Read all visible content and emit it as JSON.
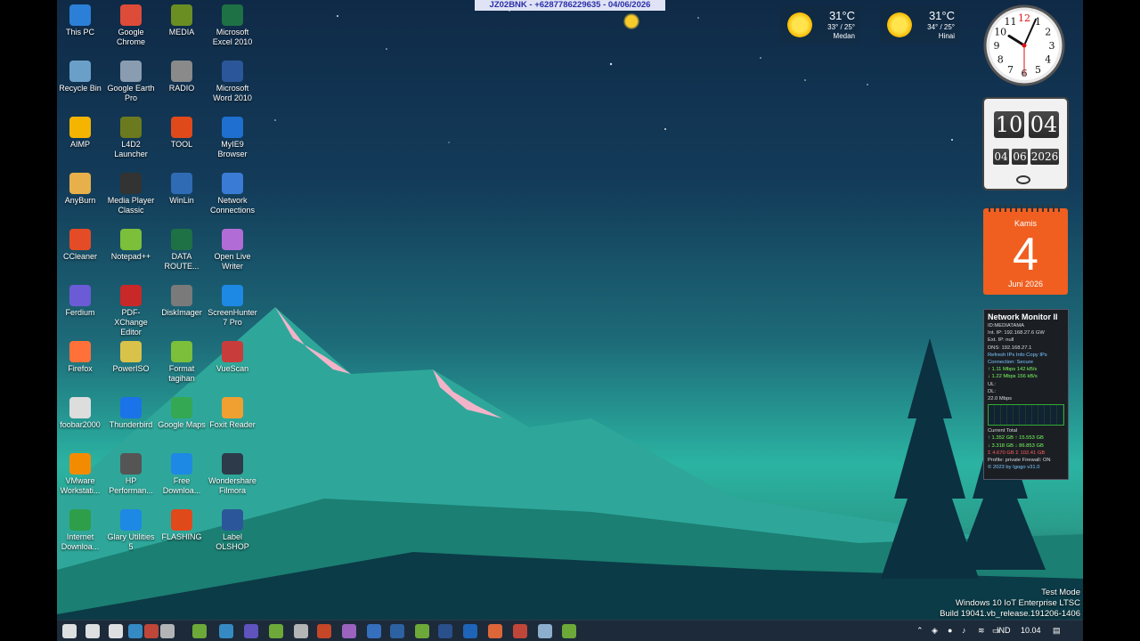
{
  "banner": "JZ02BNK - +6287786229635 - 04/06/2026",
  "desktop_icons": [
    {
      "label": "This PC",
      "icon": "computer-icon",
      "color": "#2b7fd6"
    },
    {
      "label": "Google Chrome",
      "icon": "chrome-icon",
      "color": "#dd4b39"
    },
    {
      "label": "MEDIA",
      "icon": "media-icon",
      "color": "#6b8e23"
    },
    {
      "label": "Microsoft Excel 2010",
      "icon": "excel-icon",
      "color": "#1e7145"
    },
    {
      "label": "Recycle Bin",
      "icon": "recycle-bin-icon",
      "color": "#6aa0c8"
    },
    {
      "label": "Google Earth Pro",
      "icon": "google-earth-icon",
      "color": "#8a9db0"
    },
    {
      "label": "RADIO",
      "icon": "radio-icon",
      "color": "#8a8a8a"
    },
    {
      "label": "Microsoft Word 2010",
      "icon": "word-icon",
      "color": "#2b579a"
    },
    {
      "label": "AIMP",
      "icon": "aimp-icon",
      "color": "#f5b400"
    },
    {
      "label": "L4D2 Launcher",
      "icon": "l4d2-icon",
      "color": "#6b7a1e"
    },
    {
      "label": "TOOL",
      "icon": "tool-icon",
      "color": "#e0491a"
    },
    {
      "label": "MyIE9 Browser",
      "icon": "myie9-icon",
      "color": "#1e6fcf"
    },
    {
      "label": "AnyBurn",
      "icon": "anyburn-icon",
      "color": "#e8b04a"
    },
    {
      "label": "Media Player Classic",
      "icon": "mpc-icon",
      "color": "#333333"
    },
    {
      "label": "WinLin",
      "icon": "winlin-icon",
      "color": "#2f6bb5"
    },
    {
      "label": "Network Connections",
      "icon": "network-icon",
      "color": "#3a7bd5"
    },
    {
      "label": "CCleaner",
      "icon": "ccleaner-icon",
      "color": "#e34c26"
    },
    {
      "label": "Notepad++",
      "icon": "notepadpp-icon",
      "color": "#7bbf3a"
    },
    {
      "label": "DATA ROUTE...",
      "icon": "excel-icon",
      "color": "#1e7145"
    },
    {
      "label": "Open Live Writer",
      "icon": "writer-icon",
      "color": "#b16cd6"
    },
    {
      "label": "Ferdium",
      "icon": "ferdium-icon",
      "color": "#6b5bd6"
    },
    {
      "label": "PDF-XChange Editor",
      "icon": "pdf-icon",
      "color": "#c82828"
    },
    {
      "label": "DiskImager",
      "icon": "diskimager-icon",
      "color": "#7a7a7a"
    },
    {
      "label": "ScreenHunter 7 Pro",
      "icon": "screenhunter-icon",
      "color": "#1e88e5"
    },
    {
      "label": "Firefox",
      "icon": "firefox-icon",
      "color": "#ff7139"
    },
    {
      "label": "PowerISO",
      "icon": "poweriso-icon",
      "color": "#d9c24a"
    },
    {
      "label": "Format tagihan",
      "icon": "notepadpp-icon",
      "color": "#7bbf3a"
    },
    {
      "label": "VueScan",
      "icon": "vuescan-icon",
      "color": "#c83c3c"
    },
    {
      "label": "foobar2000",
      "icon": "foobar-icon",
      "color": "#dddddd"
    },
    {
      "label": "Thunderbird",
      "icon": "thunderbird-icon",
      "color": "#1a73e8"
    },
    {
      "label": "Google Maps",
      "icon": "maps-icon",
      "color": "#34a853"
    },
    {
      "label": "Foxit Reader",
      "icon": "foxit-icon",
      "color": "#f0a030"
    },
    {
      "label": "VMware Workstati...",
      "icon": "vmware-icon",
      "color": "#f38b00"
    },
    {
      "label": "HP Performan...",
      "icon": "hp-icon",
      "color": "#555555"
    },
    {
      "label": "Free Downloa...",
      "icon": "download-icon",
      "color": "#1e88e5"
    },
    {
      "label": "Wondershare Filmora",
      "icon": "filmora-icon",
      "color": "#2d3a4a"
    },
    {
      "label": "Internet Downloa...",
      "icon": "idm-icon",
      "color": "#2e9e4a"
    },
    {
      "label": "Glary Utilities 5",
      "icon": "glary-icon",
      "color": "#1e88e5"
    },
    {
      "label": "FLASHING",
      "icon": "flashing-icon",
      "color": "#e0491a"
    },
    {
      "label": "Label OLSHOP",
      "icon": "word-icon",
      "color": "#2b579a"
    }
  ],
  "weather": [
    {
      "temp": "31°C",
      "range": "33° / 25°",
      "city": "Medan"
    },
    {
      "temp": "31°C",
      "range": "34° / 25°",
      "city": "Hinai"
    }
  ],
  "flip_clock": {
    "hour": "10",
    "minute": "04",
    "day": "04",
    "month": "06",
    "year": "2026"
  },
  "calendar": {
    "weekday": "Kamis",
    "day": "4",
    "month_year": "Juni 2026"
  },
  "network_monitor": {
    "title": "Network Monitor II",
    "lines": [
      {
        "text": "ID:MEDIATAMA",
        "cls": ""
      },
      {
        "text": "Int. IP: 192.168.27.6    GW",
        "cls": ""
      },
      {
        "text": "Ext. IP: null",
        "cls": ""
      },
      {
        "text": "DNS: 192.168.27.1",
        "cls": ""
      },
      {
        "text": "Refresh IPs   Info   Copy IPs",
        "cls": "b"
      },
      {
        "text": "Connection: Secure",
        "cls": "b"
      },
      {
        "text": "↑ 1.11 Mbps    142 kB/s",
        "cls": "g"
      },
      {
        "text": "↓ 1.22 Mbps    156 kB/s",
        "cls": "g"
      },
      {
        "text": "UL:",
        "cls": ""
      },
      {
        "text": "DL:",
        "cls": ""
      },
      {
        "text": "22.0 Mbps",
        "cls": ""
      }
    ],
    "totals": [
      {
        "text": "Current        Total",
        "cls": ""
      },
      {
        "text": "↑ 1.352 GB    ↑ 15.553 GB",
        "cls": "g"
      },
      {
        "text": "↓ 3.318 GB    ↓ 86.853 GB",
        "cls": "g"
      },
      {
        "text": "Σ 4.670 GB    Σ 102.41 GB",
        "cls": "r"
      },
      {
        "text": "Profile: private   Firewall: ON",
        "cls": ""
      },
      {
        "text": "© 2023 by Igogo        v31.0",
        "cls": "b"
      }
    ]
  },
  "system_info": {
    "line1": "Test Mode",
    "line2": "Windows 10 IoT Enterprise LTSC",
    "line3": "Build 19041.vb_release.191206-1406"
  },
  "analog_clock": {
    "hour": 10,
    "minute": 4,
    "second": 30
  },
  "taskbar": {
    "apps": [
      {
        "icon": "start-icon",
        "color": "#ffffff"
      },
      {
        "icon": "search-icon",
        "color": "#ffffff"
      },
      {
        "icon": "task-view-icon",
        "color": "#ffffff"
      },
      {
        "icon": "edge-icon",
        "color": "#3a9bdc"
      },
      {
        "icon": "chrome-icon",
        "color": "#dd4b39"
      },
      {
        "icon": "window-icon",
        "color": "#cccccc"
      },
      {
        "icon": "notepadpp-icon",
        "color": "#7bbf3a"
      },
      {
        "icon": "edge-icon",
        "color": "#3a9bdc"
      },
      {
        "icon": "ferdium-icon",
        "color": "#6b5bd6"
      },
      {
        "icon": "notepadpp-icon",
        "color": "#7bbf3a"
      },
      {
        "icon": "file-icon",
        "color": "#cccccc"
      },
      {
        "icon": "ccleaner-icon",
        "color": "#e34c26"
      },
      {
        "icon": "writer-icon",
        "color": "#b16cd6"
      },
      {
        "icon": "network-icon",
        "color": "#3a7bd5"
      },
      {
        "icon": "winlin-icon",
        "color": "#2f6bb5"
      },
      {
        "icon": "notepadpp-icon",
        "color": "#7bbf3a"
      },
      {
        "icon": "r-icon",
        "color": "#2b579a"
      },
      {
        "icon": "google-earth-icon",
        "color": "#1e6fcf"
      },
      {
        "icon": "firefox-icon",
        "color": "#ff7139"
      },
      {
        "icon": "chrome-icon",
        "color": "#dd4b39"
      },
      {
        "icon": "notepad-icon",
        "color": "#9fc7e8"
      },
      {
        "icon": "calc-icon",
        "color": "#7bbf3a"
      }
    ],
    "language": "IND",
    "time": "10.04"
  }
}
